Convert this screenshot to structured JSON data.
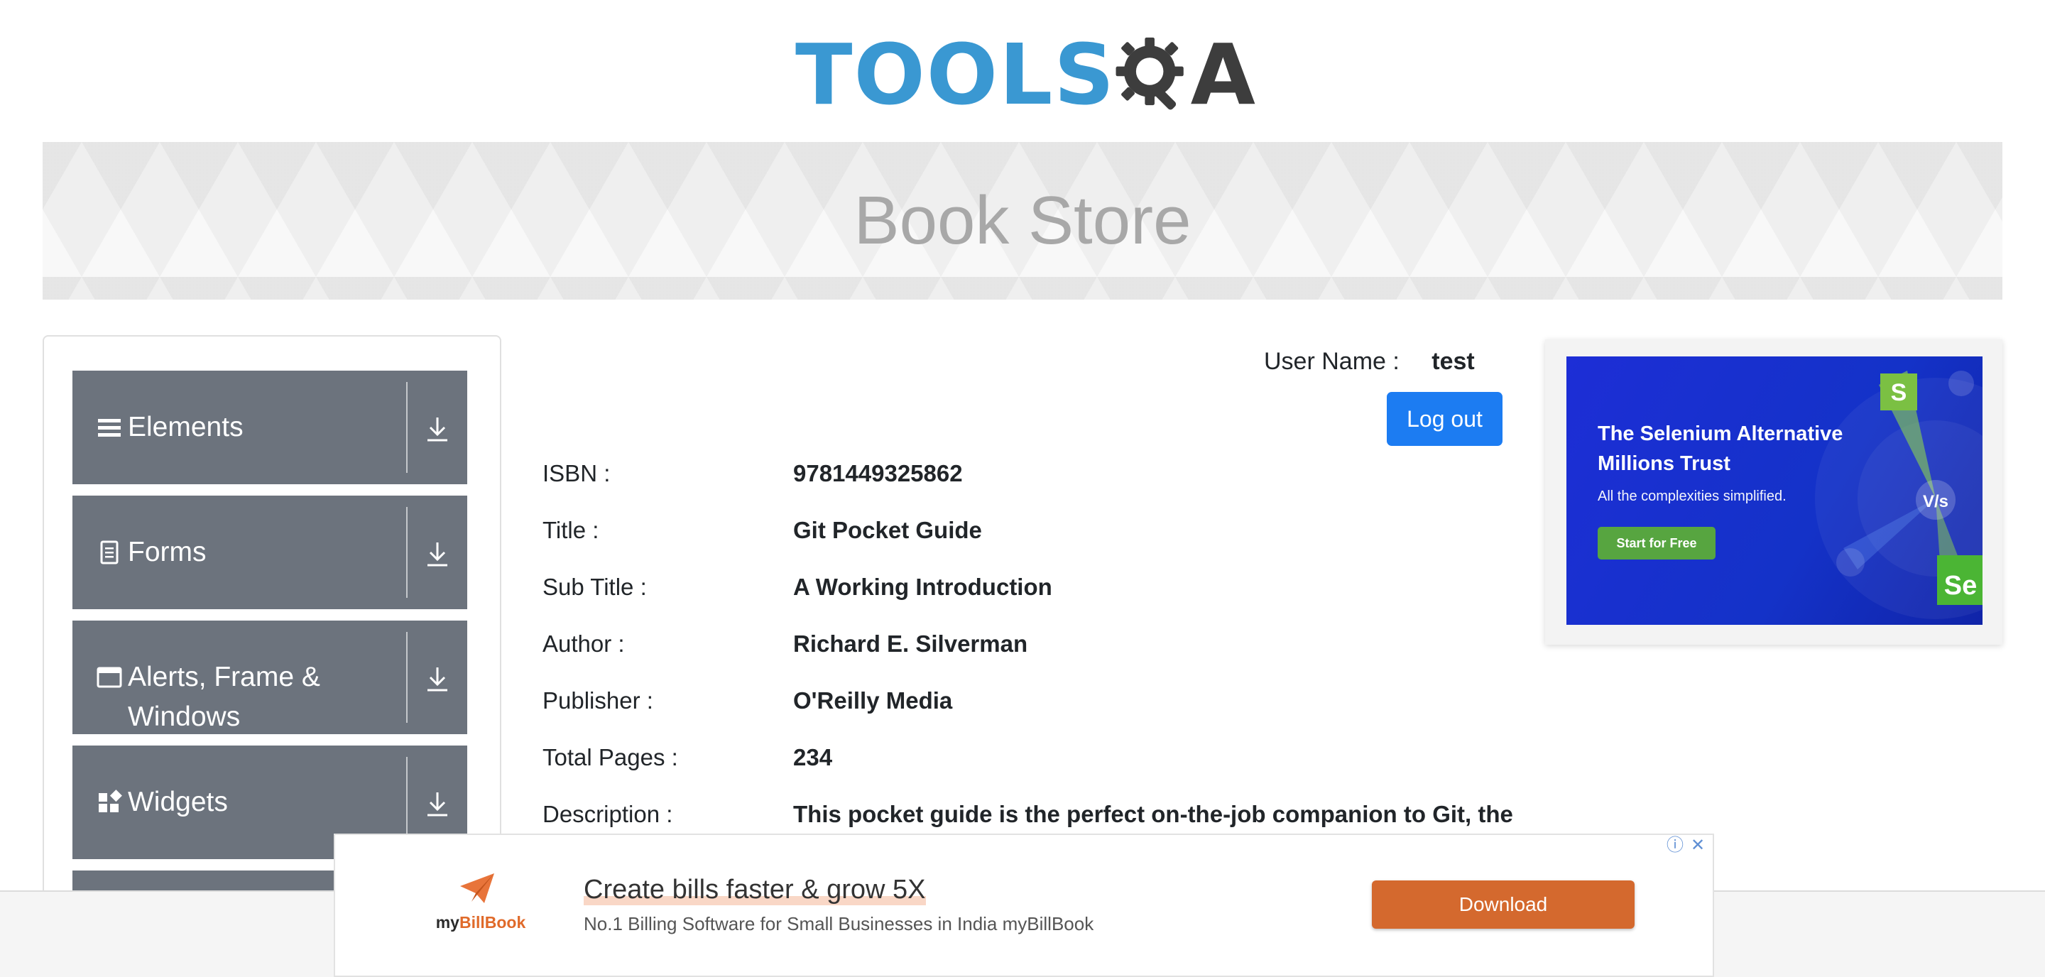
{
  "header": {
    "logo_tools": "TOOLS",
    "logo_q": "Q",
    "logo_a": "A"
  },
  "banner": {
    "title": "Book Store"
  },
  "nav": {
    "groups": [
      {
        "label": "Elements",
        "icon": "list-icon"
      },
      {
        "label": "Forms",
        "icon": "document-icon"
      },
      {
        "label": "Alerts, Frame & Windows",
        "icon": "window-icon"
      },
      {
        "label": "Widgets",
        "icon": "widgets-icon"
      }
    ]
  },
  "user": {
    "label": "User Name :",
    "name": "test",
    "logout_label": "Log out"
  },
  "book": {
    "fields": [
      {
        "key": "ISBN :",
        "value": "9781449325862"
      },
      {
        "key": "Title :",
        "value": "Git Pocket Guide"
      },
      {
        "key": "Sub Title :",
        "value": "A Working Introduction"
      },
      {
        "key": "Author :",
        "value": "Richard E. Silverman"
      },
      {
        "key": "Publisher :",
        "value": "O'Reilly Media"
      },
      {
        "key": "Total Pages :",
        "value": "234"
      },
      {
        "key": "Description :",
        "value": "This pocket guide is the perfect on-the-job companion to Git, the"
      }
    ]
  },
  "side_ad": {
    "headline": "The Selenium Alternative Millions Trust",
    "subtext": "All the complexities simplified.",
    "cta": "Start for Free",
    "badge_s": "S",
    "badge_vs": "V/s",
    "badge_se": "Se"
  },
  "bottom_ad": {
    "brand_prefix": "my",
    "brand_name": "BillBook",
    "headline": "Create bills faster & grow 5X",
    "description": "No.1 Billing Software for Small Businesses in India myBillBook",
    "button": "Download"
  },
  "colors": {
    "nav_bg": "#6c737d",
    "primary_button": "#1c7cf2",
    "logo_blue": "#3a98d2",
    "ad_orange": "#d4692e"
  }
}
